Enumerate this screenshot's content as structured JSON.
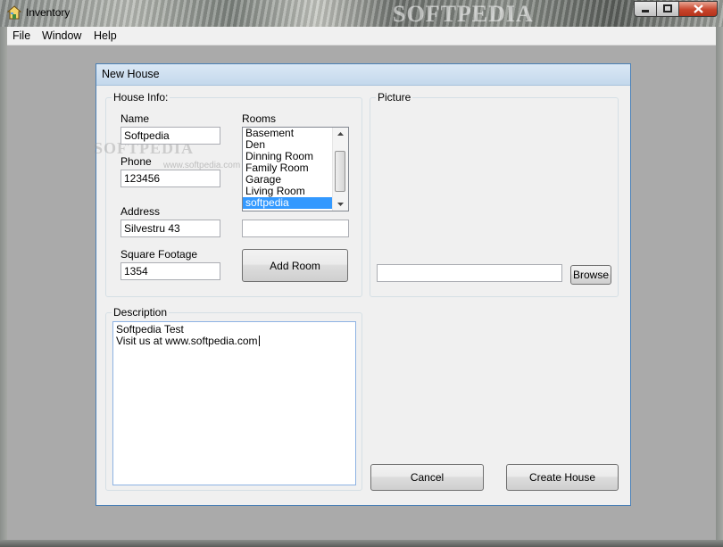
{
  "window": {
    "title": "Inventory",
    "watermark": "SOFTPEDIA",
    "caption_buttons": [
      "minimize-icon",
      "maximize-icon",
      "close-icon"
    ]
  },
  "menu": {
    "items": [
      {
        "label": "File"
      },
      {
        "label": "Window"
      },
      {
        "label": "Help"
      }
    ]
  },
  "form": {
    "title": "New House",
    "house_info": {
      "legend": "House Info:",
      "name_label": "Name",
      "name_value": "Softpedia",
      "phone_label": "Phone",
      "phone_value": "123456",
      "address_label": "Address",
      "address_value": "Silvestru 43",
      "sqft_label": "Square Footage",
      "sqft_value": "1354",
      "rooms_label": "Rooms",
      "rooms": [
        "Basement",
        "Den",
        "Dinning Room",
        "Family Room",
        "Garage",
        "Living Room",
        "softpedia"
      ],
      "selected_room": "softpedia",
      "new_room_value": "",
      "add_room_label": "Add Room"
    },
    "picture": {
      "legend": "Picture",
      "path_value": "",
      "browse_label": "Browse"
    },
    "description": {
      "legend": "Description",
      "line1": "Softpedia Test",
      "line2": "Visit us at www.softpedia.com"
    },
    "cancel_label": "Cancel",
    "create_label": "Create House",
    "watermark_name": "SOFTPEDIA",
    "watermark_url": "www.softpedia.com"
  },
  "colors": {
    "selection": "#3399ff",
    "close_button": "#c8452c",
    "mdi_background": "#aaaaaa"
  }
}
